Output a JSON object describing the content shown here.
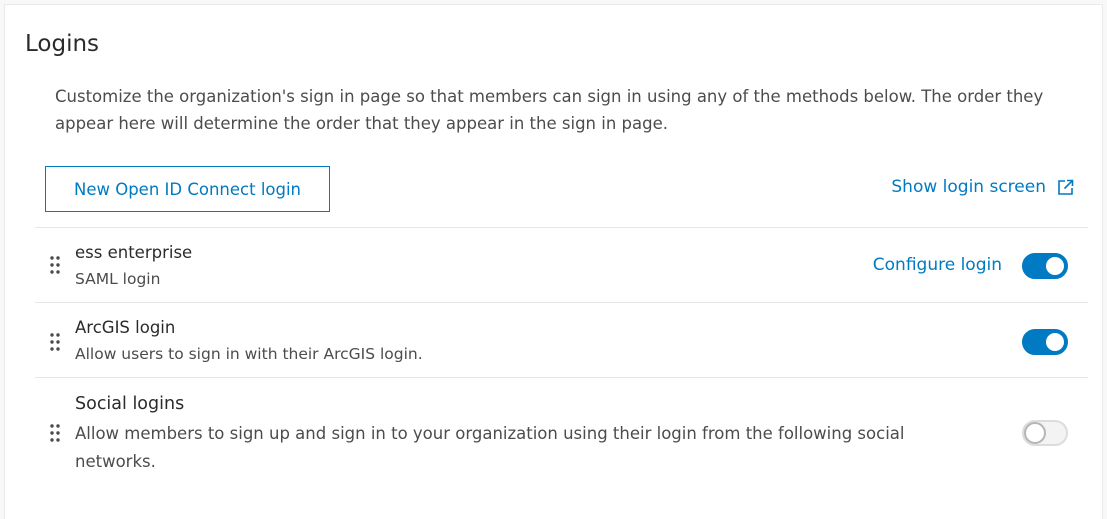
{
  "section": {
    "title": "Logins",
    "description": "Customize the organization's sign in page so that members can sign in using any of the methods below. The order they appear here will determine the order that they appear in the sign in page."
  },
  "actions": {
    "new_button_label": "New Open ID Connect login",
    "show_link_label": "Show login screen"
  },
  "logins": [
    {
      "title": "ess enterprise",
      "subtitle": "SAML login",
      "configure_label": "Configure login",
      "enabled": true
    },
    {
      "title": "ArcGIS login",
      "subtitle": "Allow users to sign in with their ArcGIS login.",
      "enabled": true
    },
    {
      "title": "Social logins",
      "subtitle": "Allow members to sign up and sign in to your organization using their login from the following social networks.",
      "enabled": false
    }
  ],
  "colors": {
    "accent": "#007ac2",
    "text": "#4c4c4c",
    "heading": "#2b2b2b"
  },
  "icons": {
    "external": "external-link-icon",
    "drag": "drag-handle-icon"
  }
}
